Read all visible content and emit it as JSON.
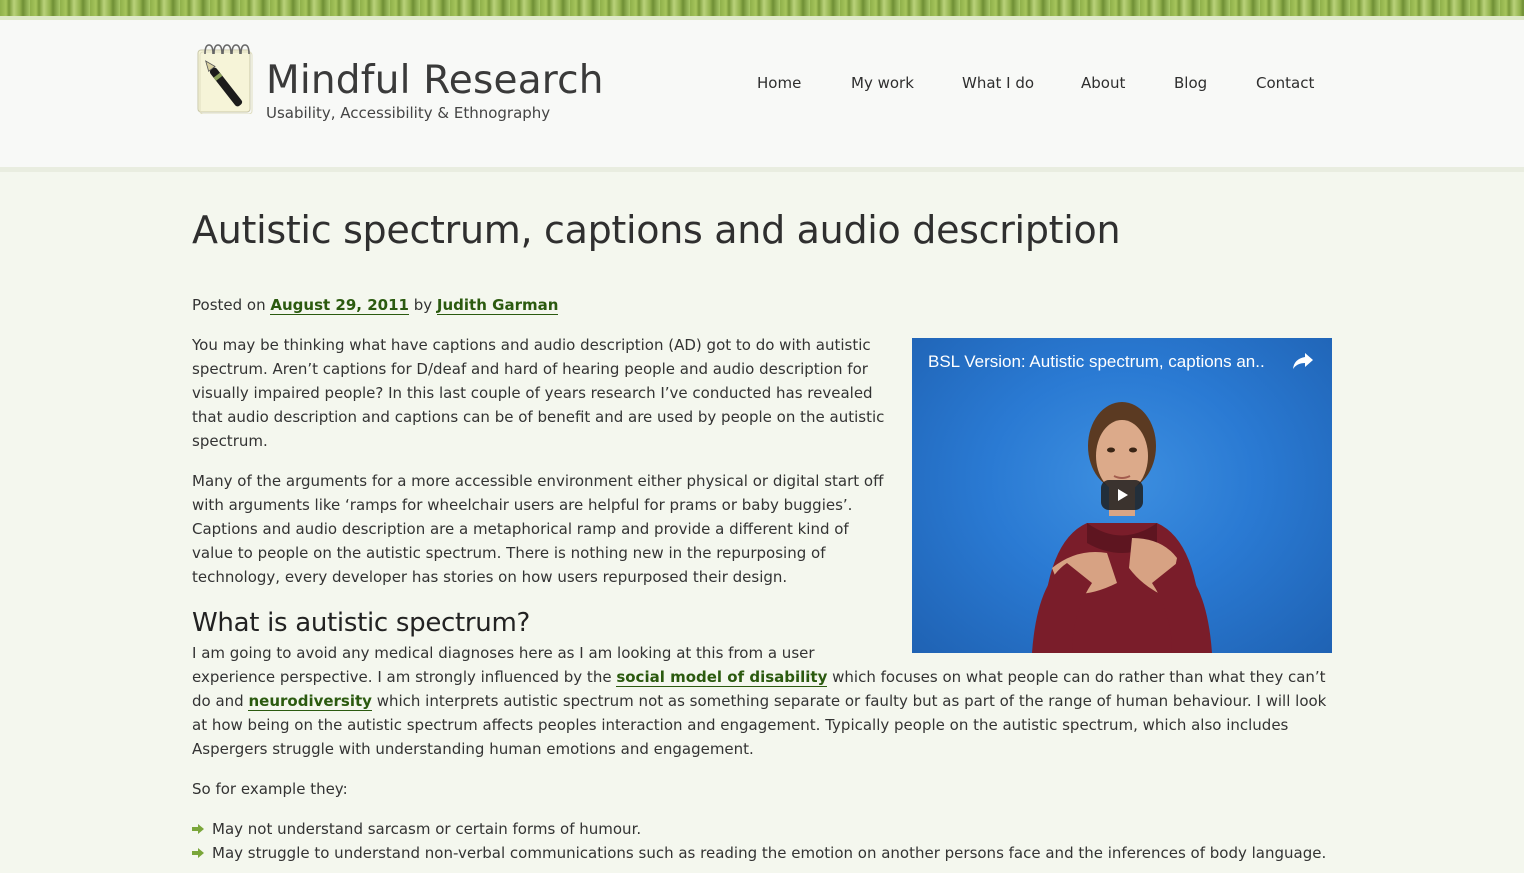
{
  "site": {
    "title": "Mindful Research",
    "tagline": "Usability, Accessibility & Ethnography"
  },
  "nav": {
    "items": [
      {
        "label": "Home"
      },
      {
        "label": "My work"
      },
      {
        "label": "What I do"
      },
      {
        "label": "About"
      },
      {
        "label": "Blog"
      },
      {
        "label": "Contact"
      }
    ]
  },
  "post": {
    "title": "Autistic spectrum, captions and audio description",
    "meta": {
      "posted_on": "Posted on",
      "date": "August 29, 2011",
      "by": "by",
      "author": "Judith Garman"
    },
    "video": {
      "title": "BSL Version: Autistic spectrum, captions an..",
      "share_icon": "share-arrow-icon",
      "play_icon": "play-icon"
    },
    "paragraphs": [
      "You may be thinking what have captions and audio description (AD) got to do with autistic spectrum. Aren’t captions for D/deaf and hard of hearing people and audio description for visually impaired people? In this last couple of years research I’ve conducted has revealed that audio description and captions can be of benefit and are used by people on the autistic spectrum.",
      "Many of the arguments for a more accessible environment either physical or digital start off with arguments like ‘ramps for wheelchair users are helpful for prams or baby buggies’. Captions and audio description are a metaphorical ramp and provide a different kind of value to people on the autistic spectrum. There is nothing new in the repurposing of technology, every developer has stories on how users repurposed their design."
    ],
    "section_heading": "What is autistic spectrum?",
    "section_paragraph": {
      "part1": "I am going to avoid any medical diagnoses here as I am looking at this from a user experience perspective. I am strongly influenced by the ",
      "link1": "social model of disability",
      "part2": " which focuses on what people can do rather than what they can’t do and ",
      "link2": "neurodiversity",
      "part3": " which interprets autistic spectrum not as something separate or faulty but as part of the range of human behaviour. I will look at how being on the autistic spectrum affects peoples interaction and engagement. Typically people on the autistic spectrum, which also includes Aspergers struggle with understanding human emotions and engagement."
    },
    "example_intro": "So for example they:",
    "list_items": [
      "May not understand sarcasm or certain forms of humour.",
      "May struggle to understand non-verbal communications such as reading the emotion on another persons face and the inferences of body language."
    ]
  },
  "colors": {
    "background": "#f4f7ee",
    "header_bg": "#f8f9f7",
    "link": "#2b5a0f",
    "video_bg": "#2a7ad3",
    "bullet": "#7aa63a"
  }
}
